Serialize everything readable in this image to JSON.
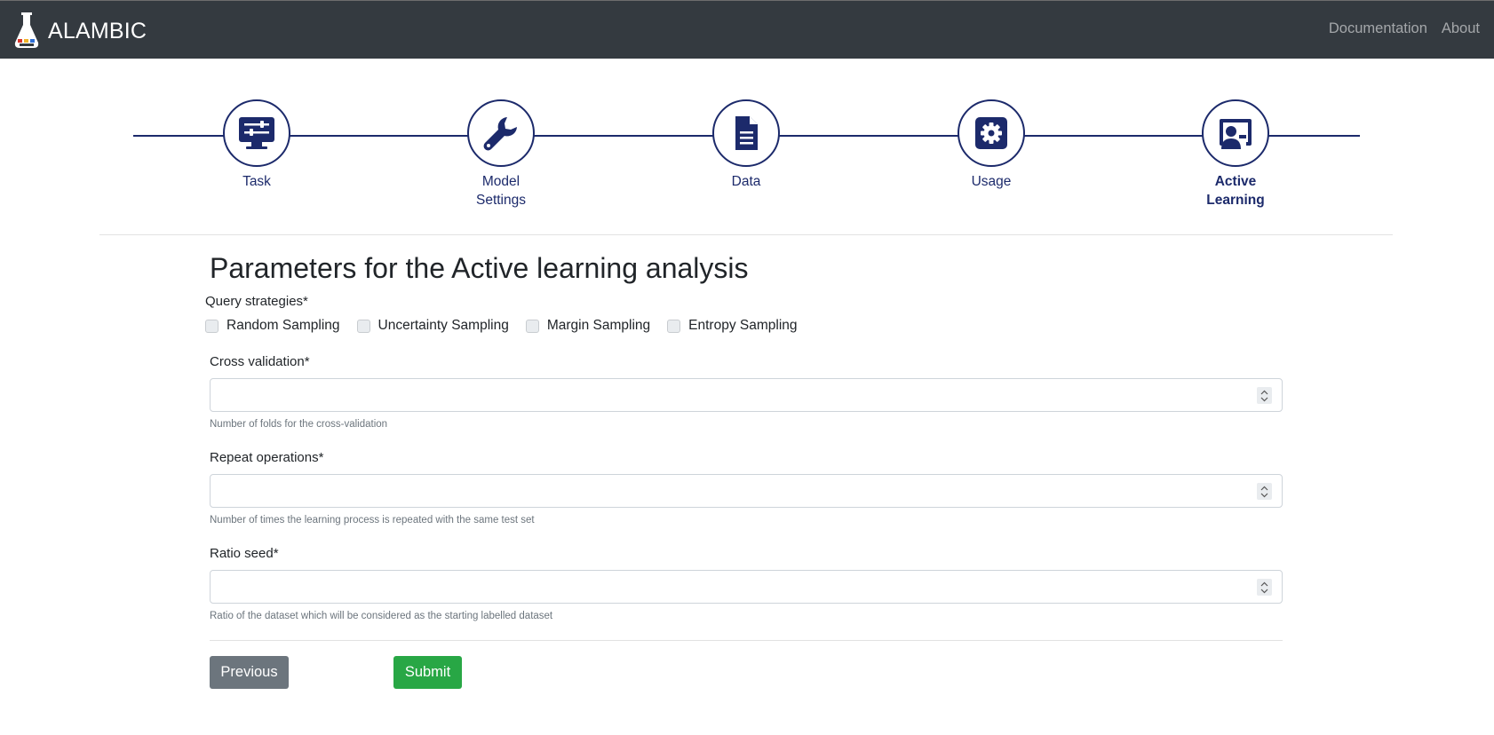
{
  "app": {
    "brand": "ALAMBIC",
    "nav": [
      "Documentation",
      "About"
    ]
  },
  "stepper": {
    "steps": [
      {
        "label": "Task",
        "icon": "task-sliders-icon",
        "active": false
      },
      {
        "label": "Model Settings",
        "icon": "wrench-icon",
        "active": false
      },
      {
        "label": "Data",
        "icon": "document-icon",
        "active": false
      },
      {
        "label": "Usage",
        "icon": "gear-icon",
        "active": false
      },
      {
        "label": "Active Learning",
        "icon": "user-board-icon",
        "active": true
      }
    ]
  },
  "form": {
    "title": "Parameters for the Active learning analysis",
    "query_strategies_label": "Query strategies*",
    "strategies": [
      "Random Sampling",
      "Uncertainty Sampling",
      "Margin Sampling",
      "Entropy Sampling"
    ],
    "cross_validation": {
      "label": "Cross validation*",
      "value": "",
      "help": "Number of folds for the cross-validation"
    },
    "repeat_operations": {
      "label": "Repeat operations*",
      "value": "",
      "help": "Number of times the learning process is repeated with the same test set"
    },
    "ratio_seed": {
      "label": "Ratio seed*",
      "value": "",
      "help": "Ratio of the dataset which will be considered as the starting labelled dataset"
    },
    "previous_label": "Previous",
    "submit_label": "Submit"
  },
  "colors": {
    "navbar": "#343a40",
    "accent": "#1c2a6b",
    "submit": "#28a745",
    "previous": "#6c757d"
  }
}
